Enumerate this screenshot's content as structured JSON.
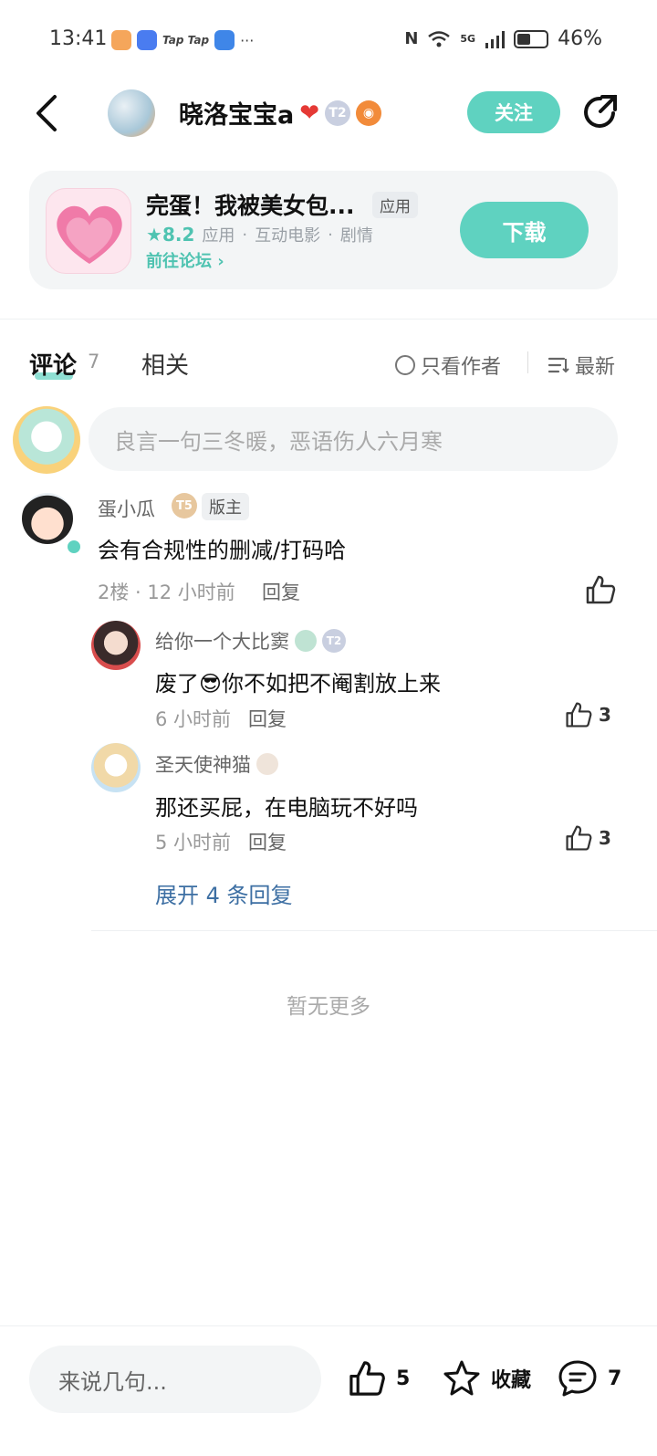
{
  "status_bar": {
    "time": "13:41",
    "app_icons": [
      "taobao-icon",
      "honor-icon",
      "taptap-icon",
      "taptap-icon",
      "weather-icon"
    ],
    "taptap_label": "Tap Tap",
    "more": "···",
    "network": "5G",
    "battery": "46%"
  },
  "header": {
    "author_name": "晓洛宝宝a",
    "level_badge": "T2",
    "follow_label": "关注"
  },
  "game_card": {
    "title": "完蛋！我被美女包...",
    "tag": "应用",
    "rating": "8.2",
    "category_1": "应用",
    "category_2": "互动电影",
    "category_3": "剧情",
    "forum_link": "前往论坛",
    "download_label": "下载"
  },
  "tabs": {
    "comment_label": "评论",
    "comment_count": "7",
    "related_label": "相关",
    "only_author": "只看作者",
    "sort": "最新"
  },
  "comment_input": {
    "placeholder": "良言一句三冬暖，恶语伤人六月寒"
  },
  "comment": {
    "user": "蛋小瓜",
    "level": "T5",
    "role": "版主",
    "text": "会有合规性的删减/打码哈",
    "meta": "2楼 · 12 小时前",
    "reply_label": "回复"
  },
  "replies": [
    {
      "user": "给你一个大比窦",
      "level": "T2",
      "text": "废了😎你不如把不阉割放上来",
      "time": "6 小时前",
      "reply_label": "回复",
      "likes": "3"
    },
    {
      "user": "圣天使神猫",
      "text": "那还买屁，在电脑玩不好吗",
      "time": "5 小时前",
      "reply_label": "回复",
      "likes": "3"
    }
  ],
  "expand_label": "展开 4 条回复",
  "no_more": "暂无更多",
  "bottom_bar": {
    "input_placeholder": "来说几句...",
    "likes": "5",
    "favorite_label": "收藏",
    "comments": "7"
  },
  "colors": {
    "accent": "#5fd2c0",
    "link_blue": "#3d6fa3"
  }
}
